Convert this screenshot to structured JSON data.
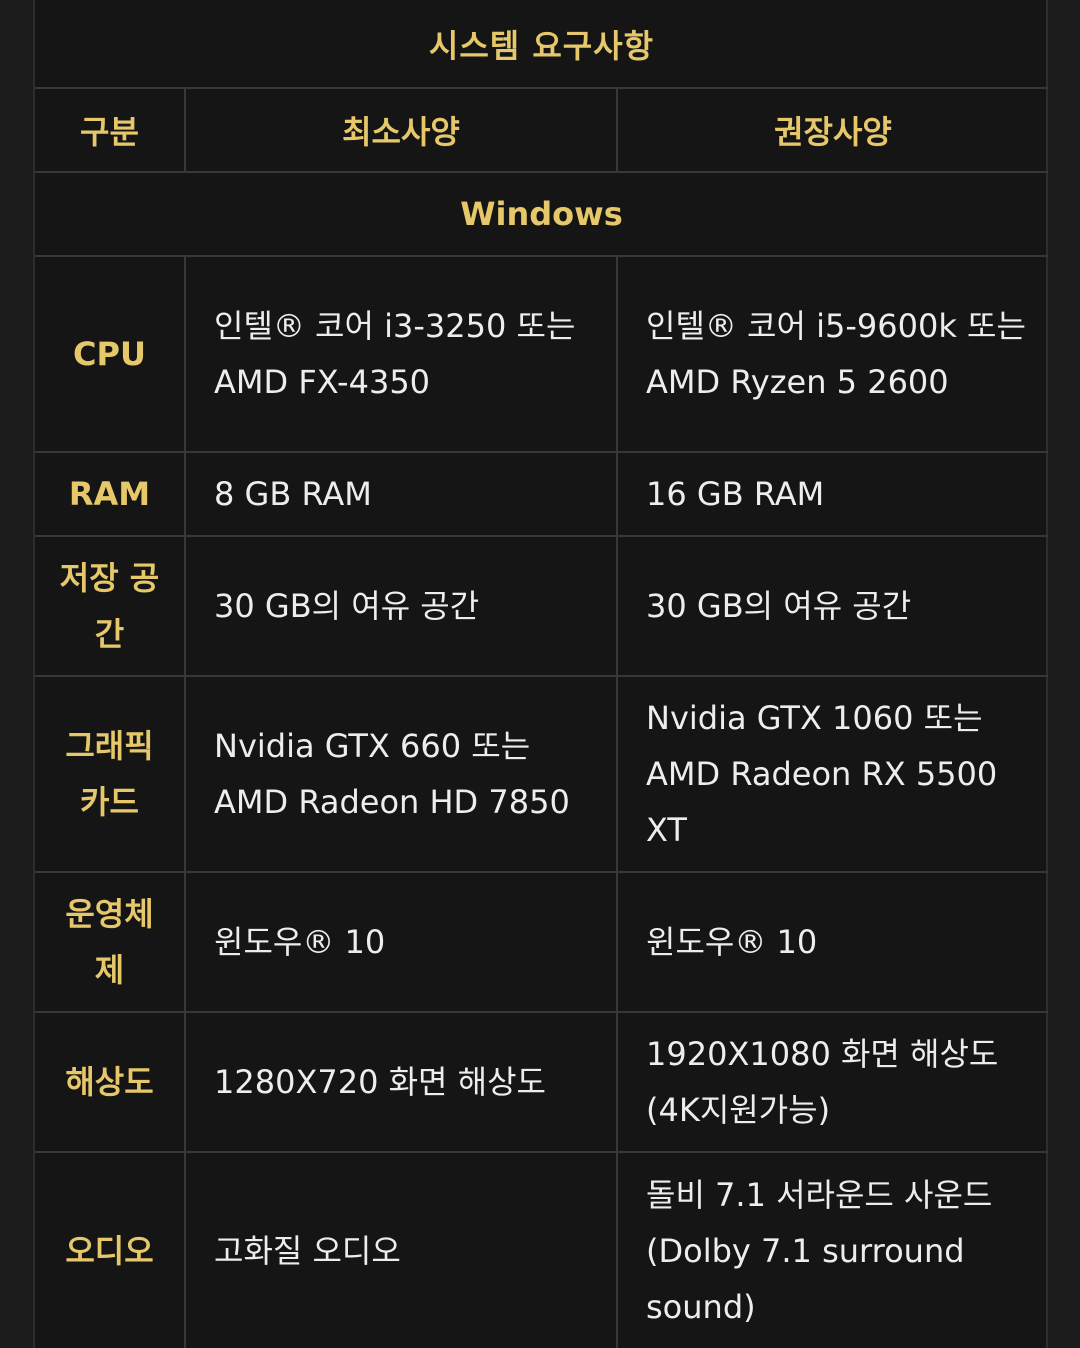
{
  "table": {
    "title": "시스템 요구사항",
    "headers": {
      "category": "구분",
      "minimum": "최소사양",
      "recommended": "권장사양"
    },
    "platform": "Windows",
    "rows": [
      {
        "label": "CPU",
        "minimum": "인텔® 코어 i3-3250 또는\nAMD FX-4350",
        "recommended": "인텔® 코어 i5-9600k 또는\nAMD Ryzen 5 2600"
      },
      {
        "label": "RAM",
        "minimum": "8 GB RAM",
        "recommended": "16 GB RAM"
      },
      {
        "label": "저장 공간",
        "minimum": "30 GB의 여유 공간",
        "recommended": "30 GB의 여유 공간"
      },
      {
        "label": "그래픽 카드",
        "minimum": "Nvidia GTX 660 또는\nAMD Radeon HD 7850",
        "recommended": "Nvidia GTX 1060 또는\nAMD Radeon RX 5500 XT"
      },
      {
        "label": "운영체제",
        "minimum": "윈도우® 10",
        "recommended": "윈도우® 10"
      },
      {
        "label": "해상도",
        "minimum": "1280X720 화면 해상도",
        "recommended": "1920X1080 화면 해상도 (4K지원가능)"
      },
      {
        "label": "오디오",
        "minimum": "고화질 오디오",
        "recommended": "돌비 7.1 서라운드 사운드 (Dolby 7.1 surround sound)"
      }
    ]
  }
}
